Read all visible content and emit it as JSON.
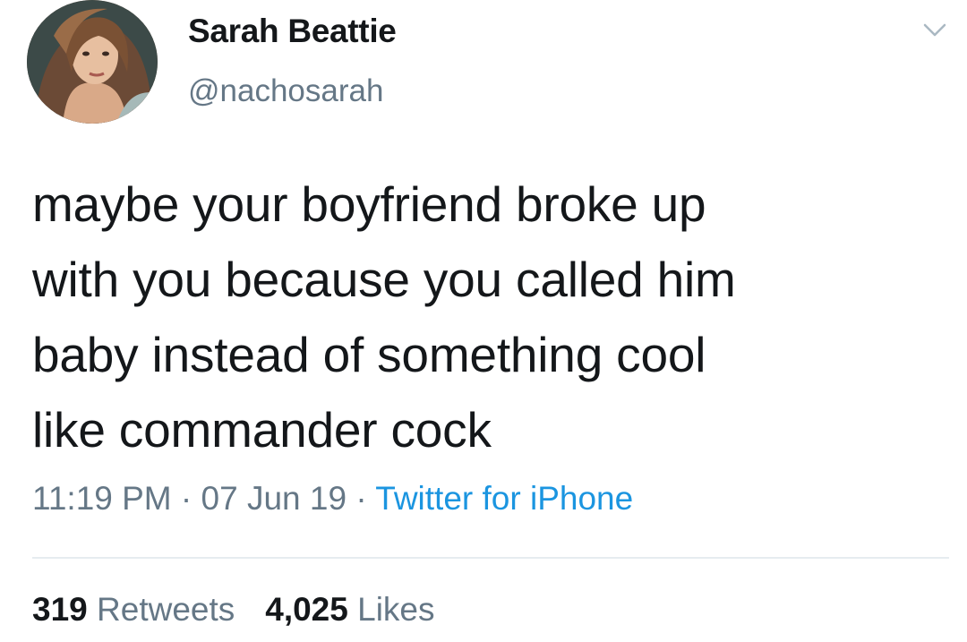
{
  "author": {
    "display_name": "Sarah Beattie",
    "handle": "@nachosarah"
  },
  "tweet": {
    "lines": [
      "maybe your boyfriend broke up",
      "with you because you called him",
      "baby instead of something cool",
      "like commander cock"
    ],
    "time": "11:19 PM",
    "separator": "·",
    "date": "07 Jun 19",
    "source": "Twitter for iPhone"
  },
  "stats": {
    "retweets_count": "319",
    "retweets_label": "Retweets",
    "likes_count": "4,025",
    "likes_label": "Likes"
  },
  "icons": {
    "menu": "chevron-down-icon"
  },
  "colors": {
    "text": "#14171a",
    "secondary": "#657786",
    "link": "#1b95e0",
    "divider": "#e6ecf0"
  }
}
